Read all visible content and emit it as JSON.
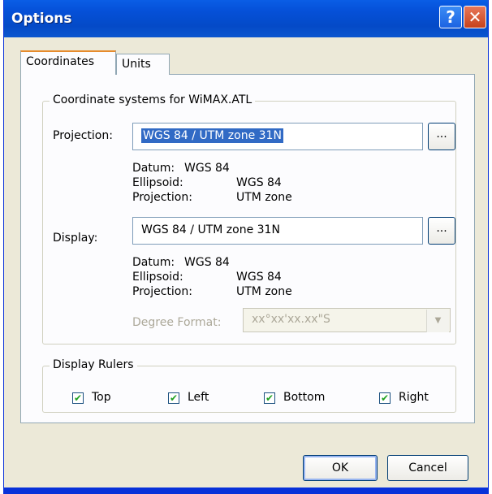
{
  "window": {
    "title": "Options"
  },
  "title_buttons": {
    "help": "?",
    "close": "✕"
  },
  "tabs": [
    {
      "label": "Coordinates",
      "selected": true
    },
    {
      "label": "Units",
      "selected": false
    }
  ],
  "coord_group": {
    "title": "Coordinate systems for WiMAX.ATL",
    "projection_label": "Projection:",
    "projection_value": "WGS 84 / UTM zone 31N",
    "projection_browse": "...",
    "proj_info": {
      "datum_label": "Datum:",
      "datum_value": "WGS 84",
      "ellipsoid_label": "Ellipsoid:",
      "ellipsoid_value": "WGS 84",
      "projection_label": "Projection:",
      "projection_value": "UTM zone"
    },
    "display_label": "Display:",
    "display_value": "WGS 84 / UTM zone 31N",
    "display_browse": "...",
    "disp_info": {
      "datum_label": "Datum:",
      "datum_value": "WGS 84",
      "ellipsoid_label": "Ellipsoid:",
      "ellipsoid_value": "WGS 84",
      "projection_label": "Projection:",
      "projection_value": "UTM zone"
    },
    "degree_format_label": "Degree Format:",
    "degree_format_value": "xx°xx'xx.xx\"S"
  },
  "rulers_group": {
    "title": "Display Rulers",
    "items": [
      {
        "label": "Top",
        "checked": true
      },
      {
        "label": "Left",
        "checked": true
      },
      {
        "label": "Bottom",
        "checked": true
      },
      {
        "label": "Right",
        "checked": true
      }
    ]
  },
  "buttons": {
    "ok": "OK",
    "cancel": "Cancel"
  },
  "icons": {
    "check": "checkmark-icon",
    "dropdown": "chevron-down-icon"
  },
  "colors": {
    "titlebar": "#0550d8",
    "dialog_bg": "#ece9d8",
    "selection": "#316ac5"
  }
}
